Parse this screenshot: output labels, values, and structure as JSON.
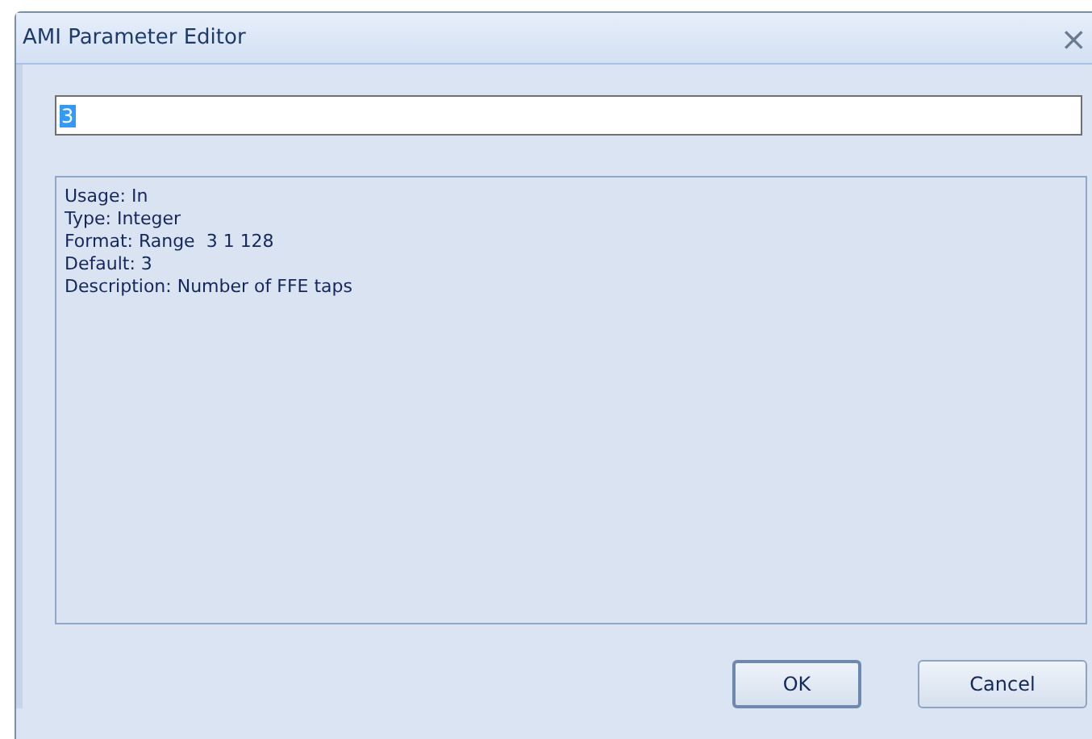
{
  "window": {
    "title": "AMI Parameter Editor",
    "close": "×"
  },
  "value_field": {
    "value": "3",
    "value_selected": true
  },
  "info": {
    "lines": [
      "Usage: In",
      "Type: Integer",
      "Format: Range  3 1 128",
      "Default: 3",
      "Description: Number of FFE taps"
    ]
  },
  "buttons": [
    {
      "label": "OK",
      "default": true
    },
    {
      "label": "Cancel",
      "default": false
    }
  ]
}
